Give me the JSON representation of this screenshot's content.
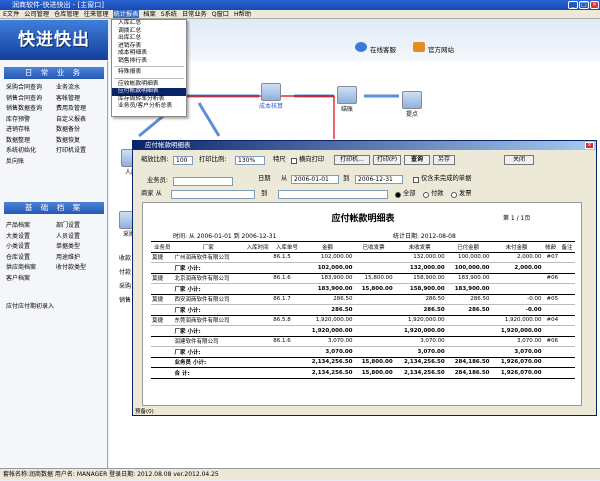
{
  "window": {
    "title": "润商软件-快进快出 - [主窗口]"
  },
  "menu": [
    "E文件",
    "公司管理",
    "仓库管理",
    "往来管理",
    "统计报表",
    "档案",
    "S系统",
    "日常业务",
    "Q窗口",
    "H帮助"
  ],
  "header": {
    "logo": "快进快出",
    "link1": "在线客服",
    "link2": "官方网站"
  },
  "sidebar": {
    "daily_title": "日 常 业 务",
    "daily_items": [
      "采购合同查询",
      "业务流水",
      "销售合同查询",
      "客帐管理",
      "销售数据查询",
      "费用及管理",
      "库存预警",
      "自定义报表",
      "进销存帐",
      "数据备份",
      "数据整理",
      "数据恢复",
      "系统初始化",
      "打印机设置",
      "反向账",
      ""
    ],
    "base_title": "基 础 档 案",
    "base_items": [
      "产品档案",
      "部门设置",
      "大类设置",
      "人员设置",
      "小类设置",
      "单据类型",
      "仓库设置",
      "用途维护",
      "供应商档案",
      "收付款类型",
      "客户档案",
      ""
    ],
    "extra_item": "应付应付期初录入"
  },
  "dropdown": {
    "items": [
      "入库汇总",
      "调拨汇总",
      "出库汇总",
      "进销存表",
      "成本明细表",
      "销售排行表",
      "---",
      "特殊报表",
      "---",
      "应收帐款明细表",
      "应付帐款明细表",
      "库存周转率分析表",
      "业务员/客户分析总表"
    ],
    "selected": 10
  },
  "flow": {
    "step1": "人库",
    "step2": "成本核算",
    "step3": "结账",
    "step4": "提点",
    "step5": "采购",
    "side1": "收款",
    "side2": "付款",
    "side3": "采购",
    "side4": "销售"
  },
  "dialog": {
    "title": "应付帐款明细表",
    "zoom_label": "缩放比例:",
    "zoom_value": "100",
    "print_label": "打印比例:",
    "print_value": "130%",
    "feature": "特尺",
    "h_print": "横向打印",
    "printer": "打印机...",
    "print_btn": "打印(P)",
    "query": "查询",
    "save": "另存",
    "close": "关闭",
    "salesman_label": "业务员:",
    "date_label": "日期",
    "from_label": "从",
    "from_value": "2006-01-01",
    "to_label": "到",
    "to_value": "2006-12-31",
    "only_unsettled": "仅含未完成的单据",
    "merchant_label": "商家 从",
    "merchant_to": "到",
    "radio_all": "全部",
    "radio_pay": "付款",
    "radio_invoice": "发票",
    "status": "预备(0)"
  },
  "report": {
    "title": "应付帐款明细表",
    "page": "第 1 / 1页",
    "time_label": "时间: 从 2006-01-01 到 2006-12-31",
    "stat_label": "统计日期: 2012-08-08",
    "headers": [
      "业务员",
      "厂家",
      "入库时间",
      "入库单号",
      "金额",
      "已收发票",
      "未收发票",
      "已付金额",
      "未付金额",
      "帐龄",
      "备注"
    ],
    "rows": [
      [
        "莫捷",
        "广州润商软件有限公司",
        "",
        "86.1.5",
        "102,000.00",
        "",
        "132,000.00",
        "100,000.00",
        "2,000.00",
        "#07",
        ""
      ],
      [
        "",
        "厂家 小计:",
        "",
        "",
        "102,000.00",
        "",
        "132,000.00",
        "100,000.00",
        "2,000.00",
        "",
        ""
      ],
      [
        "莫捷",
        "北京润商软件有限公司",
        "",
        "86.1.6",
        "183,900.00",
        "15,800.00",
        "158,900.00",
        "183,900.00",
        "",
        "#06",
        ""
      ],
      [
        "",
        "厂家 小计:",
        "",
        "",
        "183,900.00",
        "15,800.00",
        "158,900.00",
        "183,900.00",
        "",
        "",
        ""
      ],
      [
        "莫捷",
        "西安润商软件有限公司",
        "",
        "86.1.7",
        "286.50",
        "",
        "286.50",
        "286.50",
        "-0.00",
        "#05",
        ""
      ],
      [
        "",
        "厂家 小计:",
        "",
        "",
        "286.50",
        "",
        "286.50",
        "286.50",
        "-0.00",
        "",
        ""
      ],
      [
        "莫捷",
        "东莞润商软件有限公司",
        "",
        "86.5.8",
        "1,920,000.00",
        "",
        "1,920,000.00",
        "",
        "1,920,000.00",
        "#04",
        ""
      ],
      [
        "",
        "厂家 小计:",
        "",
        "",
        "1,920,000.00",
        "",
        "1,920,000.00",
        "",
        "1,920,000.00",
        "",
        ""
      ],
      [
        "",
        "润建软件有限公司",
        "",
        "86.1.6",
        "3,070.00",
        "",
        "3,070.00",
        "",
        "3,070.00",
        "#06",
        ""
      ],
      [
        "",
        "厂家 小计:",
        "",
        "",
        "3,070.00",
        "",
        "3,070.00",
        "",
        "3,070.00",
        "",
        ""
      ],
      [
        "",
        "业务员 小计:",
        "",
        "",
        "2,134,256.50",
        "15,800.00",
        "2,134,256.50",
        "284,186.50",
        "1,926,070.00",
        "",
        ""
      ],
      [
        "",
        "合 计:",
        "",
        "",
        "2,134,256.50",
        "15,800.00",
        "2,134,256.50",
        "284,186.50",
        "1,926,070.00",
        "",
        ""
      ]
    ]
  },
  "statusbar": {
    "text": "套帐名称:润商数据   用户名: MANAGER   登录日期: 2012.08.08   ver.2012.04.25"
  }
}
